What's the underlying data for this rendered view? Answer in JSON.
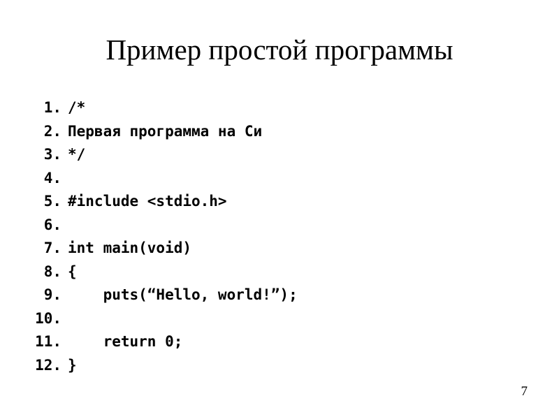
{
  "slide": {
    "title": "Пример простой программы",
    "page_number": "7",
    "background_color": "#ffffff",
    "text_color": "#000000"
  },
  "code_listing": {
    "language": "C",
    "lines": [
      {
        "number": "1.",
        "code": "/*"
      },
      {
        "number": "2.",
        "code": "Первая программа на Си"
      },
      {
        "number": "3.",
        "code": "*/"
      },
      {
        "number": "4.",
        "code": ""
      },
      {
        "number": "5.",
        "code": "#include <stdio.h>"
      },
      {
        "number": "6.",
        "code": ""
      },
      {
        "number": "7.",
        "code": "int main(void)"
      },
      {
        "number": "8.",
        "code": "{"
      },
      {
        "number": "9.",
        "code": "    puts(“Hello, world!”);"
      },
      {
        "number": "10.",
        "code": ""
      },
      {
        "number": "11.",
        "code": "    return 0;"
      },
      {
        "number": "12.",
        "code": "}"
      }
    ]
  }
}
